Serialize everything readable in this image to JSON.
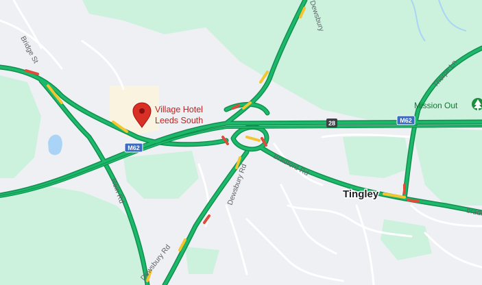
{
  "map": {
    "poi": {
      "name_line1": "Village Hotel",
      "name_line2": "Leeds South",
      "marker": "map-pin-icon"
    },
    "place": {
      "name": "Tingley"
    },
    "park": {
      "name": "Mission Out",
      "icon": "tree-icon"
    },
    "motorway": {
      "shield_west": "M62",
      "shield_east": "M62",
      "junction": "28"
    },
    "roads": {
      "bridge_st": "Bridge St",
      "dewsbury_top": "Dewsbury",
      "dewsbury_mid": "Dewsbury Rd",
      "dewsbury_bottom": "Dewsbury Rd",
      "bradford_rd": "Bradford Rd",
      "bradford_east": "bradf",
      "rein_rd": "Rein Rd",
      "thorpe_ln": "Thorpe Ln"
    },
    "colors": {
      "land": "#eef0f3",
      "green": "#ccf2dd",
      "traffic_free": "#1eb86a",
      "traffic_slow": "#f4c431",
      "traffic_heavy": "#e04b3a",
      "water": "#aad4f5",
      "poi_red": "#d93025"
    }
  }
}
